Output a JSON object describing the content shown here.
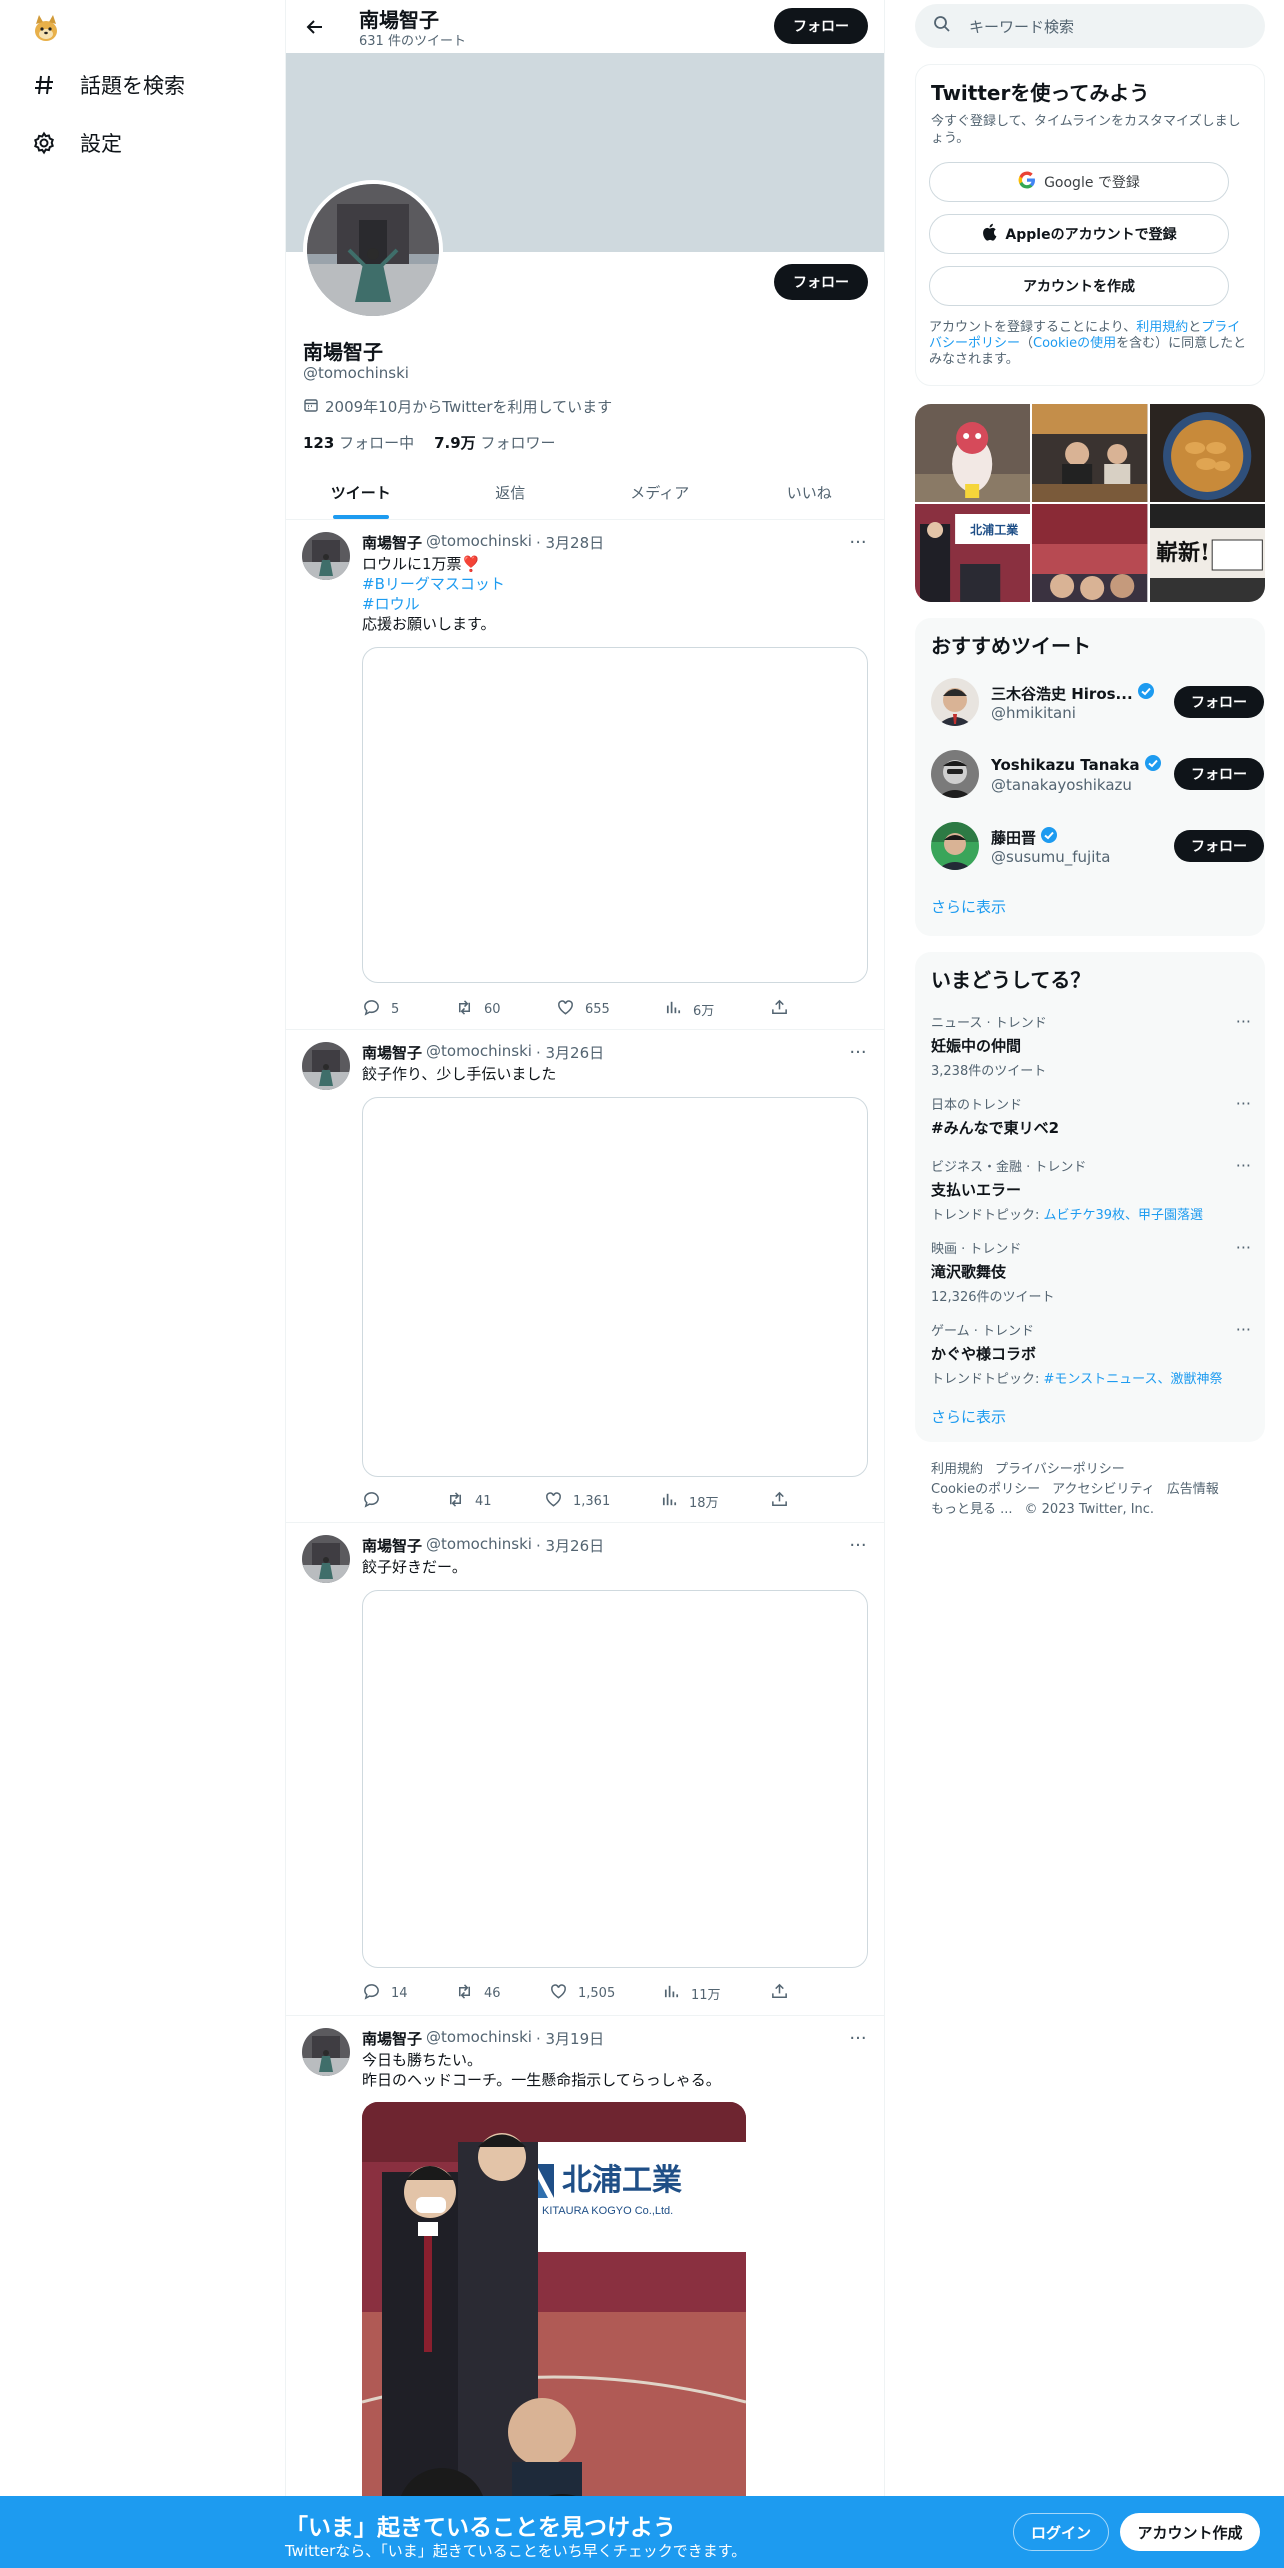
{
  "nav": {
    "explore_label": "話題を検索",
    "settings_label": "設定"
  },
  "profile": {
    "name": "南場智子",
    "tweet_count": "631 件のツイート",
    "follow_label": "フォロー",
    "handle": "@tomochinski",
    "joined": "2009年10月からTwitterを利用しています",
    "following_count": "123",
    "following_label": "フォロー中",
    "followers_count": "7.9万",
    "followers_label": "フォロワー"
  },
  "tabs": [
    {
      "label": "ツイート"
    },
    {
      "label": "返信"
    },
    {
      "label": "メディア"
    },
    {
      "label": "いいね"
    }
  ],
  "tweets": [
    {
      "name": "南場智子",
      "handle": "@tomochinski",
      "date": "· 3月28日",
      "lines": [
        "ロウルに1万票❣️",
        "#Bリーグマスコット",
        "#ロウル",
        "応援お願いします。"
      ],
      "replies": "5",
      "retweets": "60",
      "likes": "655",
      "views": "6万"
    },
    {
      "name": "南場智子",
      "handle": "@tomochinski",
      "date": "· 3月26日",
      "lines": [
        "餃子作り、少し手伝いました"
      ],
      "replies": "",
      "retweets": "41",
      "likes": "1,361",
      "views": "18万"
    },
    {
      "name": "南場智子",
      "handle": "@tomochinski",
      "date": "· 3月26日",
      "lines": [
        "餃子好きだー。"
      ],
      "replies": "14",
      "retweets": "46",
      "likes": "1,505",
      "views": "11万"
    },
    {
      "name": "南場智子",
      "handle": "@tomochinski",
      "date": "· 3月19日",
      "lines": [
        "今日も勝ちたい。",
        "昨日のヘッドコーチ。一生懸命指示してらっしゃる。"
      ],
      "media_text_1": "北浦工業",
      "media_text_2": "KITAURA KOGYO Co.,Ltd."
    }
  ],
  "search": {
    "placeholder": "キーワード検索"
  },
  "signup": {
    "title": "Twitterを使ってみよう",
    "desc": "今すぐ登録して、タイムラインをカスタマイズしましょう。",
    "google": "Google で登録",
    "apple": "Appleのアカウントで登録",
    "create": "アカウントを作成",
    "legal_1": "アカウントを登録することにより、",
    "legal_terms": "利用規約",
    "legal_2": "と",
    "legal_privacy": "プライバシーポリシー",
    "legal_3": "（",
    "legal_cookie": "Cookieの使用",
    "legal_4": "を含む）に同意したとみなされます。"
  },
  "media_grid": {
    "tile5_text": "北浦工業",
    "tile6_text": "嶄新!"
  },
  "recommended": {
    "title": "おすすめツイート",
    "users": [
      {
        "name": "三木谷浩史 Hiros...",
        "handle": "@hmikitani",
        "follow": "フォロー"
      },
      {
        "name": "Yoshikazu Tanaka",
        "handle": "@tanakayoshikazu",
        "follow": "フォロー"
      },
      {
        "name": "藤田晋",
        "handle": "@susumu_fujita",
        "follow": "フォロー"
      }
    ],
    "more": "さらに表示"
  },
  "trends": {
    "title": "いまどうしてる？",
    "items": [
      {
        "category": "ニュース · トレンド",
        "name": "妊娠中の仲間",
        "sub": "3,238件のツイート"
      },
      {
        "category": "日本のトレンド",
        "name": "#みんなで東リベ2",
        "sub": ""
      },
      {
        "category": "ビジネス・金融 · トレンド",
        "name": "支払いエラー",
        "sub_prefix": "トレンドトピック: ",
        "sub_links": "ムビチケ39枚、甲子園落選"
      },
      {
        "category": "映画 · トレンド",
        "name": "滝沢歌舞伎",
        "sub": "12,326件のツイート"
      },
      {
        "category": "ゲーム · トレンド",
        "name": "かぐや様コラボ",
        "sub_prefix": "トレンドトピック: ",
        "sub_links": "#モンストニュース、激獣神祭"
      }
    ],
    "more": "さらに表示"
  },
  "footer": {
    "terms": "利用規約",
    "privacy": "プライバシーポリシー",
    "cookie": "Cookieのポリシー",
    "accessibility": "アクセシビリティ",
    "ads": "広告情報",
    "more": "もっと見る ...",
    "copyright": "© 2023 Twitter, Inc."
  },
  "bottom_bar": {
    "title": "「いま」起きていることを見つけよう",
    "subtitle": "Twitterなら、「いま」起きていることをいち早くチェックできます。",
    "login": "ログイン",
    "signup": "アカウント作成"
  },
  "colors": {
    "accent": "#1d9bf0",
    "text": "#0f1419",
    "muted": "#536471",
    "banner": "#cfd9de"
  }
}
